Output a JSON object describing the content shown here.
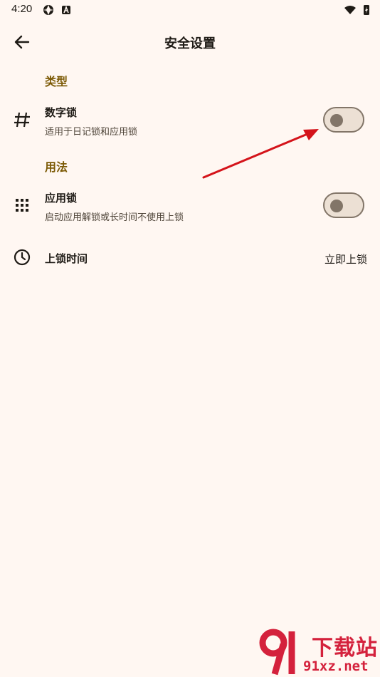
{
  "status_bar": {
    "time": "4:20"
  },
  "header": {
    "title": "安全设置"
  },
  "sections": [
    {
      "header": "类型"
    },
    {
      "header": "用法"
    }
  ],
  "settings": {
    "number_lock": {
      "title": "数字锁",
      "subtitle": "适用于日记锁和应用锁",
      "enabled": false
    },
    "app_lock": {
      "title": "应用锁",
      "subtitle": "启动应用解锁或长时间不使用上锁",
      "enabled": false
    },
    "lock_time": {
      "title": "上锁时间",
      "value": "立即上锁"
    }
  },
  "icons": {
    "back": "arrow-left-icon",
    "number_lock": "hash-icon",
    "app_lock": "grid-icon",
    "lock_time": "clock-icon"
  },
  "annotation": {
    "color": "#d4131a"
  },
  "watermark": {
    "top": "下载站",
    "bottom": "91xz.net"
  }
}
